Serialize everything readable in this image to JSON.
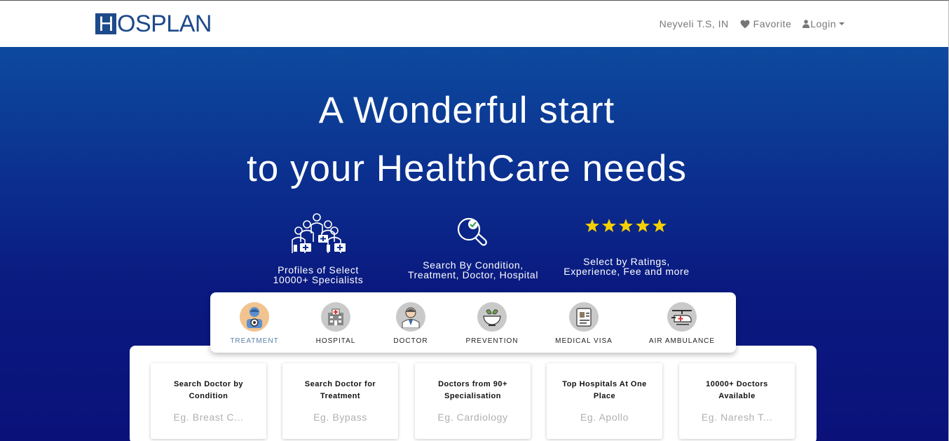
{
  "brand": {
    "logo_first": "H",
    "logo_rest": "OSPLAN"
  },
  "nav": {
    "location": "Neyveli T.S, IN",
    "favorite": "Favorite",
    "login": "Login"
  },
  "hero": {
    "line1": "A Wonderful start",
    "line2": "to your HealthCare needs"
  },
  "features": [
    {
      "icon": "doctors-group-icon",
      "line1": "Profiles of Select",
      "line2": "10000+ Specialists"
    },
    {
      "icon": "search-check-icon",
      "line1": "Search By Condition,",
      "line2": "Treatment, Doctor, Hospital"
    },
    {
      "icon": "five-stars-icon",
      "line1": "Select by Ratings,",
      "line2": "Experience, Fee and more"
    }
  ],
  "categories": [
    {
      "label": "TREATMENT",
      "icon": "treatment-icon",
      "active": true
    },
    {
      "label": "HOSPITAL",
      "icon": "hospital-icon",
      "active": false
    },
    {
      "label": "DOCTOR",
      "icon": "doctor-icon",
      "active": false
    },
    {
      "label": "PREVENTION",
      "icon": "prevention-icon",
      "active": false
    },
    {
      "label": "MEDICAL VISA",
      "icon": "medical-visa-icon",
      "active": false
    },
    {
      "label": "AIR AMBULANCE",
      "icon": "air-ambulance-icon",
      "active": false
    }
  ],
  "search_cards": [
    {
      "title_line1": "Search Doctor by",
      "title_line2": "Condition",
      "placeholder": "Eg. Breast C..."
    },
    {
      "title_line1": "Search Doctor for",
      "title_line2": "Treatment",
      "placeholder": "Eg. Bypass"
    },
    {
      "title_line1": "Doctors from 90+",
      "title_line2": "Specialisation",
      "placeholder": "Eg. Cardiology"
    },
    {
      "title_line1": "Top Hospitals At One",
      "title_line2": "Place",
      "placeholder": "Eg. Apollo"
    },
    {
      "title_line1": "10000+ Doctors",
      "title_line2": "Available",
      "placeholder": "Eg. Naresh T..."
    }
  ],
  "colors": {
    "brand": "#1d4a8a",
    "hero_top": "#0d4a9e",
    "hero_bottom": "#0a127a",
    "star": "#f5d000",
    "active_tab": "#5a7fa8"
  }
}
